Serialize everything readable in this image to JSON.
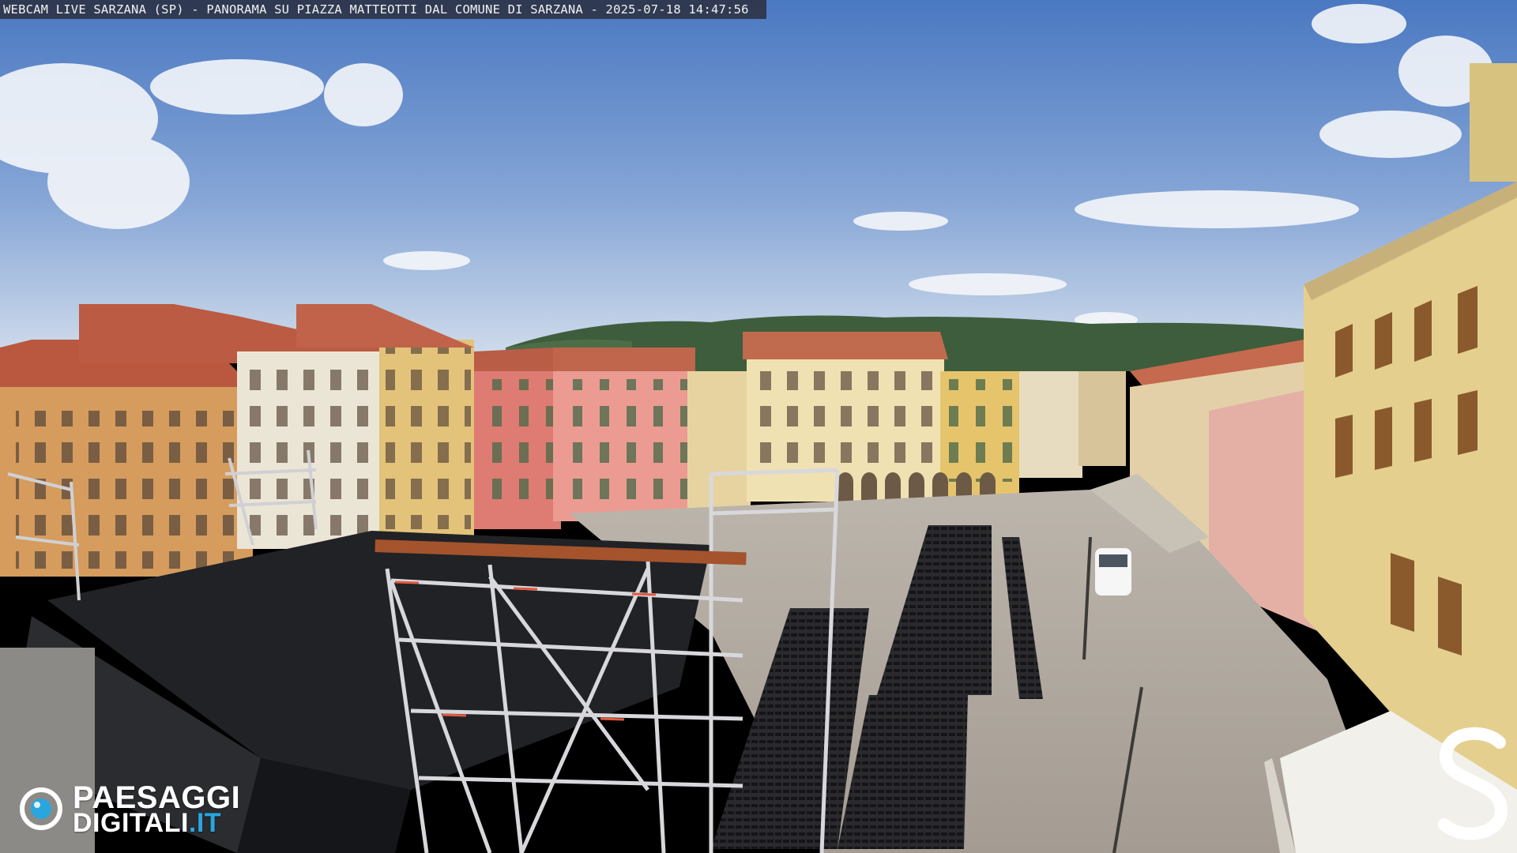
{
  "overlay": {
    "caption": "WEBCAM LIVE SARZANA (SP) - PANORAMA SU PIAZZA MATTEOTTI DAL COMUNE DI SARZANA - 2025-07-18  14:47:56"
  },
  "logo": {
    "line1": "PAESAGGI",
    "line2": "DIGITALI",
    "tld": ".IT",
    "accent": "#2aa6df"
  },
  "corner_mark": {
    "glyph": "S"
  },
  "scene_palette": {
    "sky_top": "#4f7cc4",
    "sky_horizon": "#c9d7ea",
    "roof": "#c0604a",
    "facade_ochre": "#d9a05c",
    "facade_pink": "#e07c78",
    "facade_cream": "#eadcb0",
    "pavement": "#b3aba1",
    "stage_cover": "#26282c",
    "seats": "#1e1e22"
  }
}
